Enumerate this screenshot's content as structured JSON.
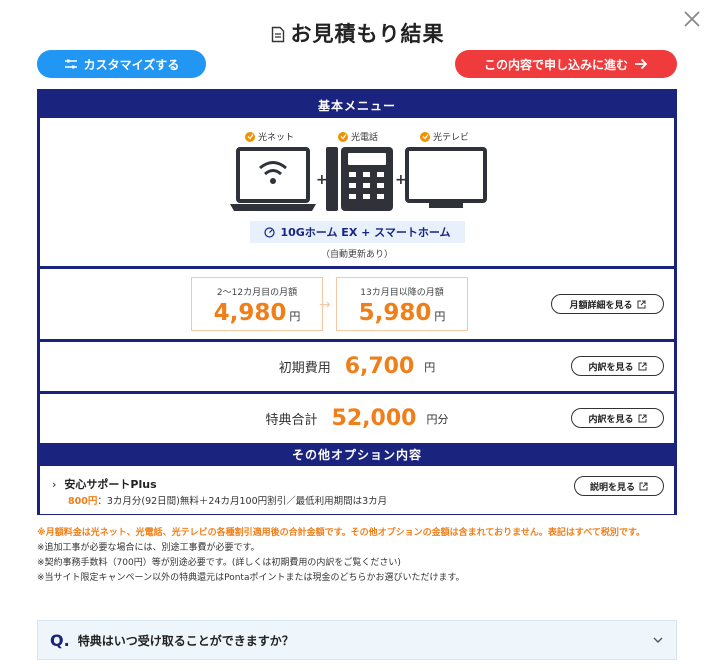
{
  "page": {
    "title": "お見積もり結果"
  },
  "buttons": {
    "customize": "カスタマイズする",
    "apply": "この内容で申し込みに進む"
  },
  "basic_menu": {
    "header": "基本メニュー",
    "services": [
      "光ネット",
      "光電話",
      "光テレビ"
    ],
    "plan_name": "10Gホーム EX + スマートホーム",
    "auto_renew": "（自動更新あり）"
  },
  "monthly": {
    "card1_caption": "2～12カ月目の月額",
    "card1_amount": "4,980",
    "card2_caption": "13カ月目以降の月額",
    "card2_amount": "5,980",
    "unit": "円",
    "detail_button": "月額詳細を見る"
  },
  "initial_fee": {
    "label": "初期費用",
    "amount": "6,700",
    "unit": "円",
    "button": "内訳を見る"
  },
  "benefit_total": {
    "label": "特典合計",
    "amount": "52,000",
    "unit": "円分",
    "button": "内訳を見る"
  },
  "other_options": {
    "header": "その他オプション内容",
    "name": "安心サポートPlus",
    "price": "800円",
    "description": "：3カ月分(92日間)無料＋24カ月100円割引／最低利用期間は3カ月",
    "button": "説明を見る"
  },
  "notes": {
    "highlight": "※月額料金は光ネット、光電話、光テレビの各種割引適用後の合計金額です。その他オプションの金額は含まれておりません。表記はすべて税別です。",
    "line1": "※追加工事が必要な場合には、別途工事費が必要です。",
    "line2": "※契約事務手数料（700円）等が別途必要です。(詳しくは初期費用の内訳をご覧ください)",
    "line3": "※当サイト限定キャンペーン以外の特典還元はPontaポイントまたは現金のどちらかお選びいただけます。"
  },
  "faq": {
    "q_mark": "Q.",
    "question": "特典はいつ受け取ることができますか？"
  },
  "colors": {
    "navy": "#1a237e",
    "blue_button": "#2196f3",
    "red_button": "#ef3b3b",
    "orange": "#f07f1a"
  }
}
